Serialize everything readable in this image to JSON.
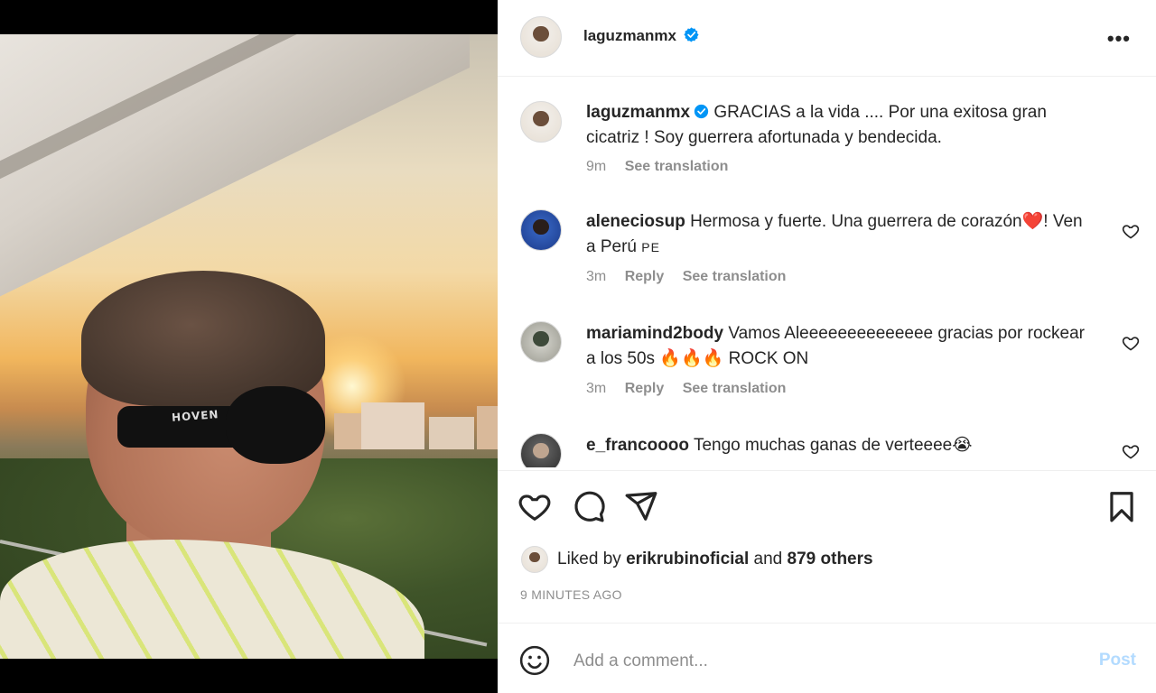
{
  "post": {
    "author": "laguzmanmx",
    "verified": true,
    "caption": {
      "username": "laguzmanmx",
      "text": "GRACIAS a la vida .... Por una exitosa gran cicatriz ! Soy guerrera afortunada y bendecida.",
      "time": "9m",
      "see_translation": "See translation"
    },
    "photo": {
      "sunglasses_brand": "HOVEN"
    }
  },
  "comments": [
    {
      "username": "aleneciosup",
      "text": "Hermosa y fuerte. Una guerrera de corazón",
      "emoji": "❤️",
      "text_after": "! Ven a Perú",
      "flag": "PE",
      "time": "3m",
      "reply": "Reply",
      "see_translation": "See translation"
    },
    {
      "username": "mariamind2body",
      "text": "Vamos Aleeeeeeeeeeeeee gracias por rockear a los 50s",
      "emoji": "🔥🔥🔥",
      "text_after": "ROCK ON",
      "time": "3m",
      "reply": "Reply",
      "see_translation": "See translation"
    },
    {
      "username": "e_francoooo",
      "text": "Tengo muchas ganas de verteeee",
      "emoji": "😭"
    }
  ],
  "likes": {
    "prefix": "Liked by",
    "user": "erikrubinoficial",
    "and": "and",
    "others": "879 others"
  },
  "time_ago": "9 MINUTES AGO",
  "comment_box": {
    "placeholder": "Add a comment...",
    "post_label": "Post"
  },
  "colors": {
    "verified_blue": "#0095f6",
    "post_button_disabled": "#b3dbff",
    "meta_gray": "#8e8e8e"
  },
  "icons": [
    "more-options-icon",
    "heart-icon",
    "comment-icon",
    "share-icon",
    "bookmark-icon",
    "emoji-icon",
    "verified-badge-icon"
  ]
}
